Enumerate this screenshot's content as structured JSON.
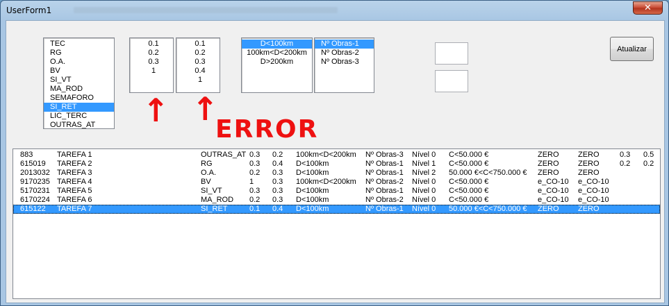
{
  "window": {
    "title": "UserForm1",
    "close_glyph": "✕"
  },
  "list_categories": [
    "TEC",
    "RG",
    "O.A.",
    "BV",
    "SI_VT",
    "MA_ROD",
    "SEMAFORO",
    "SI_RET",
    "LIC_TERC",
    "OUTRAS_AT"
  ],
  "list_categories_selected": 7,
  "list_values_a": [
    "0.1",
    "0.2",
    "0.3",
    "1"
  ],
  "list_values_b": [
    "0.1",
    "0.2",
    "0.3",
    "0.4",
    "1"
  ],
  "list_distance": [
    "D<100km",
    "100km<D<200km",
    "D>200km"
  ],
  "list_distance_selected": 0,
  "list_obras": [
    "Nº Obras-1",
    "Nº Obras-2",
    "Nº Obras-3"
  ],
  "list_obras_selected": 0,
  "buttons": {
    "atualizar": "Atualizar"
  },
  "annotation": {
    "arrow_glyph": "↑",
    "text": "ERROR",
    "color": "#ee1111"
  },
  "table_rows": [
    [
      "883",
      "TAREFA 1",
      "OUTRAS_AT",
      "0.3",
      "0.2",
      "100km<D<200km",
      "Nº Obras-3",
      "Nível 0",
      "C<50.000 €",
      "ZERO",
      "ZERO",
      "0.3",
      "0.5"
    ],
    [
      "615019",
      "TAREFA 2",
      "RG",
      "0.3",
      "0.4",
      "D<100km",
      "Nº Obras-1",
      "Nível 1",
      "C<50.000 €",
      "ZERO",
      "ZERO",
      "0.2",
      "0.2"
    ],
    [
      "2013032",
      "TAREFA 3",
      "O.A.",
      "0.2",
      "0.3",
      "D<100km",
      "Nº Obras-1",
      "Nível 2",
      "50.000 €<C<750.000 €",
      "ZERO",
      "ZERO",
      "",
      ""
    ],
    [
      "9170235",
      "TAREFA 4",
      "BV",
      "1",
      "0.3",
      "100km<D<200km",
      "Nº Obras-2",
      "Nível 0",
      "C<50.000 €",
      "e_CO-10",
      "e_CO-10",
      "",
      ""
    ],
    [
      "5170231",
      "TAREFA 5",
      "SI_VT",
      "0.3",
      "0.3",
      "D<100km",
      "Nº Obras-1",
      "Nível 0",
      "C<50.000 €",
      "e_CO-10",
      "e_CO-10",
      "",
      ""
    ],
    [
      "6170224",
      "TAREFA 6",
      "MA_ROD",
      "0.2",
      "0.3",
      "D<100km",
      "Nº Obras-2",
      "Nível 0",
      "C<50.000 €",
      "e_CO-10",
      "e_CO-10",
      "",
      ""
    ],
    [
      "615122",
      "TAREFA 7",
      "SI_RET",
      "0.1",
      "0.4",
      "D<100km",
      "Nº Obras-1",
      "Nível 0",
      "50.000 €<C<750.000 €",
      "ZERO",
      "ZERO",
      "",
      ""
    ]
  ],
  "table_selected_row": 6
}
